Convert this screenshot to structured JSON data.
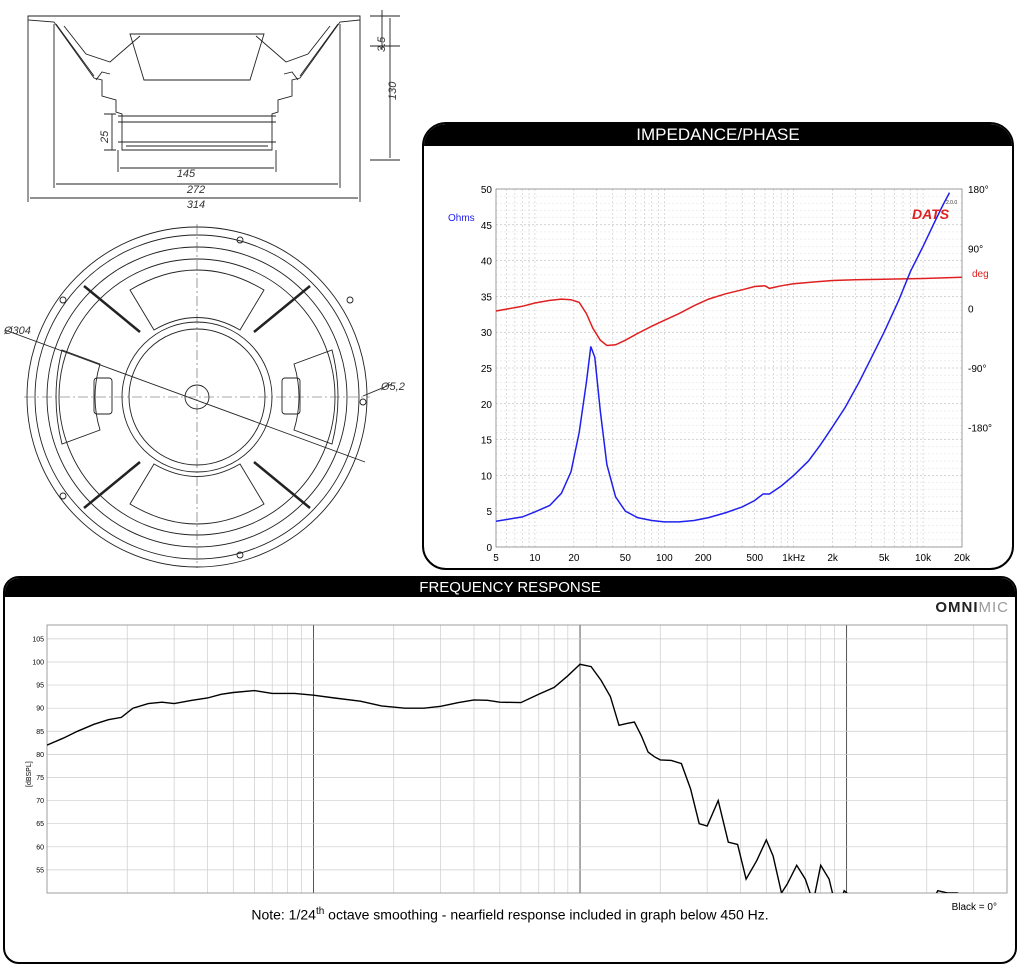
{
  "drawing": {
    "dims": {
      "d35": "3.5",
      "d130": "130",
      "d25": "25",
      "d145": "145",
      "d272": "272",
      "d314": "314",
      "d304": "Ø304",
      "d52": "Ø5,2"
    }
  },
  "impedance": {
    "title": "IMPEDANCE/PHASE",
    "logo": "DATS",
    "logo_small": "2.0.0",
    "colors": {
      "ohms": "#2020ee",
      "phase": "#e02020"
    },
    "chart_data": {
      "type": "line",
      "xlabel": "",
      "x_scale": "log",
      "xlim": [
        5,
        20000
      ],
      "x_ticks": [
        "5",
        "10",
        "20",
        "50",
        "100",
        "200",
        "500",
        "1kHz",
        "2k",
        "5k",
        "10k",
        "20k"
      ],
      "x_tick_values": [
        5,
        10,
        20,
        50,
        100,
        200,
        500,
        1000,
        2000,
        5000,
        10000,
        20000
      ],
      "y_left_label": "Ohms",
      "ylim": [
        0,
        50
      ],
      "y_ticks": [
        "0",
        "5",
        "10",
        "15",
        "20",
        "25",
        "30",
        "35",
        "40",
        "45",
        "50"
      ],
      "y_right_label": "deg",
      "phase_ylim": [
        -360,
        180
      ],
      "phase_ticks": [
        "180°",
        "90°",
        "0",
        "-90°",
        "-180°"
      ],
      "phase_tick_values": [
        180,
        90,
        0,
        -90,
        -180
      ],
      "series": [
        {
          "name": "Ohms",
          "axis": "left",
          "x": [
            5,
            8,
            10,
            13,
            16,
            19,
            22,
            25,
            27,
            29,
            32,
            36,
            42,
            50,
            62,
            80,
            100,
            130,
            170,
            220,
            300,
            400,
            500,
            580,
            650,
            800,
            1000,
            1300,
            1600,
            2000,
            2500,
            3200,
            4000,
            5000,
            6500,
            8000,
            10000,
            12000,
            14000,
            16000
          ],
          "y": [
            3.6,
            4.2,
            4.9,
            5.8,
            7.5,
            10.5,
            16,
            23,
            28,
            26.5,
            19,
            11.5,
            7,
            5,
            4.1,
            3.7,
            3.5,
            3.5,
            3.7,
            4.1,
            4.8,
            5.6,
            6.5,
            7.4,
            7.4,
            8.5,
            10,
            12,
            14.2,
            16.8,
            19.5,
            23,
            26.5,
            30,
            34.5,
            38.5,
            42,
            45,
            47.5,
            49.5
          ]
        },
        {
          "name": "Phase",
          "axis": "right",
          "x": [
            5,
            8,
            10,
            13,
            16,
            19,
            22,
            25,
            28,
            32,
            36,
            42,
            50,
            62,
            80,
            100,
            130,
            170,
            220,
            300,
            400,
            500,
            600,
            650,
            800,
            1000,
            1500,
            2000,
            3000,
            5000,
            10000,
            20000
          ],
          "y": [
            -4,
            3,
            8,
            12,
            14,
            13,
            9,
            -8,
            -30,
            -48,
            -56,
            -55,
            -48,
            -38,
            -27,
            -18,
            -8,
            4,
            14,
            22,
            28,
            33,
            34,
            30,
            34,
            37,
            40,
            42,
            43,
            44,
            45,
            47
          ]
        }
      ]
    }
  },
  "freq": {
    "title": "FREQUENCY RESPONSE",
    "brand_a": "OMNI",
    "brand_b": "MIC",
    "ylabel": "[dBSPL]",
    "note_pre": "Note: 1/24",
    "note_sup": "th",
    "note_post": " octave smoothing - nearfield response included in graph below 450 Hz.",
    "legend": "Black = 0°",
    "chart_data": {
      "type": "line",
      "xlabel": "",
      "x_scale": "log",
      "xlim": [
        10,
        40000
      ],
      "ylim": [
        50,
        108
      ],
      "ylabel": "[dBSPL]",
      "y_ticks": [
        "55",
        "60",
        "65",
        "70",
        "75",
        "80",
        "85",
        "90",
        "95",
        "100",
        "105"
      ],
      "y_tick_values": [
        55,
        60,
        65,
        70,
        75,
        80,
        85,
        90,
        95,
        100,
        105
      ],
      "series": [
        {
          "name": "Black = 0°",
          "x": [
            10,
            11.5,
            13,
            15,
            17,
            19,
            21,
            24,
            27,
            30,
            35,
            40,
            45,
            50,
            60,
            70,
            85,
            100,
            120,
            150,
            180,
            220,
            260,
            300,
            350,
            400,
            450,
            500,
            600,
            700,
            800,
            900,
            1000,
            1100,
            1200,
            1300,
            1400,
            1500,
            1600,
            1700,
            1800,
            1900,
            2000,
            2200,
            2400,
            2600,
            2800,
            3000,
            3300,
            3600,
            3900,
            4200,
            4600,
            5000,
            5300,
            5700,
            6000,
            6500,
            7000,
            7500,
            8000,
            8600,
            9200,
            9800,
            10500,
            11300,
            12000,
            12800,
            13600,
            14500,
            15500,
            16500,
            17500,
            18500,
            20000,
            22000,
            24000,
            26000,
            29000,
            32000
          ],
          "y": [
            82,
            83.5,
            85,
            86.5,
            87.5,
            88,
            90,
            91,
            91.3,
            91,
            91.7,
            92.2,
            93,
            93.4,
            93.8,
            93.2,
            93.2,
            92.8,
            92.2,
            91.5,
            90.5,
            90,
            90,
            90.4,
            91.2,
            91.8,
            91.7,
            91.3,
            91.2,
            93,
            94.5,
            97,
            99.5,
            99,
            96,
            92.5,
            86.3,
            86.7,
            87,
            84,
            80.5,
            79.5,
            78.8,
            78.7,
            78,
            72.5,
            65,
            64.5,
            70,
            61,
            60.5,
            53,
            57,
            61.5,
            58,
            50,
            52,
            56,
            53,
            48,
            56,
            53,
            46,
            50.5,
            49,
            46,
            45,
            44,
            44,
            44,
            45,
            44,
            44,
            45,
            46,
            50.5,
            50,
            50,
            49,
            48
          ]
        }
      ]
    }
  }
}
